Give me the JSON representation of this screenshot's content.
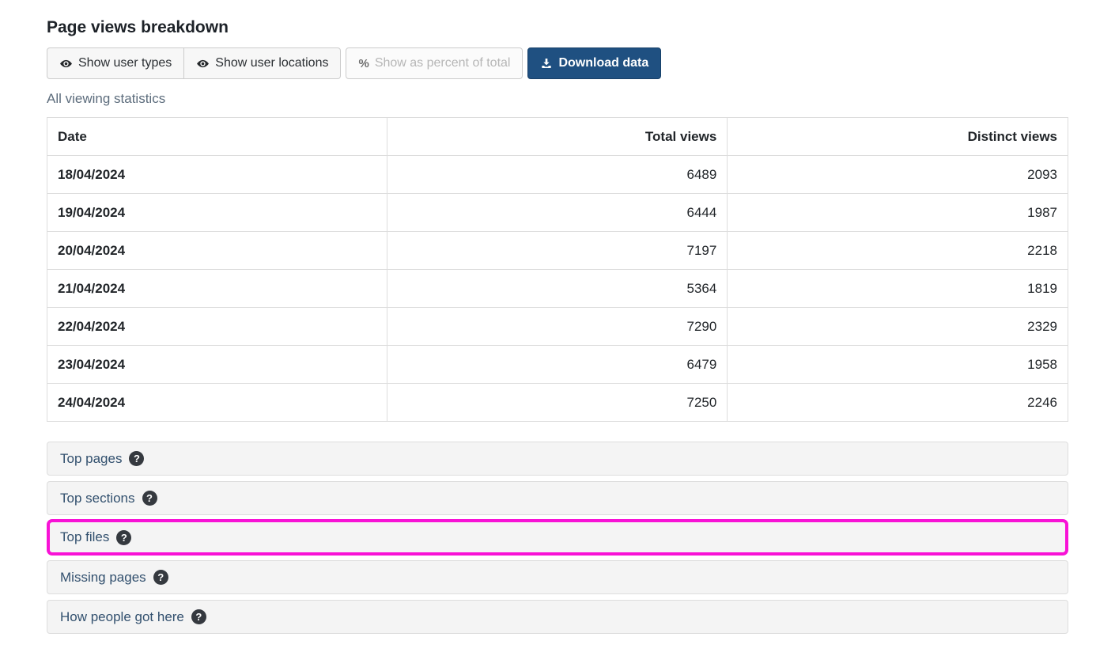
{
  "page": {
    "title": "Page views breakdown",
    "subtitle": "All viewing statistics"
  },
  "toolbar": {
    "buttons": [
      {
        "label": "Show user types",
        "icon": "eye-icon",
        "disabled": false,
        "primary": false
      },
      {
        "label": "Show user locations",
        "icon": "eye-icon",
        "disabled": false,
        "primary": false
      },
      {
        "label": "Show as percent of total",
        "icon": "percent-icon",
        "disabled": true,
        "primary": false
      },
      {
        "label": "Download data",
        "icon": "download-icon",
        "disabled": false,
        "primary": true
      }
    ]
  },
  "table": {
    "columns": [
      "Date",
      "Total views",
      "Distinct views"
    ],
    "rows": [
      {
        "date": "18/04/2024",
        "total_views": "6489",
        "distinct_views": "2093"
      },
      {
        "date": "19/04/2024",
        "total_views": "6444",
        "distinct_views": "1987"
      },
      {
        "date": "20/04/2024",
        "total_views": "7197",
        "distinct_views": "2218"
      },
      {
        "date": "21/04/2024",
        "total_views": "5364",
        "distinct_views": "1819"
      },
      {
        "date": "22/04/2024",
        "total_views": "7290",
        "distinct_views": "2329"
      },
      {
        "date": "23/04/2024",
        "total_views": "6479",
        "distinct_views": "1958"
      },
      {
        "date": "24/04/2024",
        "total_views": "7250",
        "distinct_views": "2246"
      }
    ]
  },
  "accordion": {
    "items": [
      {
        "label": "Top pages",
        "icon": "question-icon",
        "highlighted": false
      },
      {
        "label": "Top sections",
        "icon": "question-icon",
        "highlighted": false
      },
      {
        "label": "Top files",
        "icon": "question-icon",
        "highlighted": true
      },
      {
        "label": "Missing pages",
        "icon": "question-icon",
        "highlighted": false
      },
      {
        "label": "How people got here",
        "icon": "question-icon",
        "highlighted": false
      }
    ]
  },
  "icons": {
    "question_glyph": "?"
  },
  "colors": {
    "primary_button": "#1f5081",
    "highlight_border": "#f812d6",
    "accordion_label": "#32506e",
    "subtitle_text": "#5c6c7c",
    "table_border": "#dddddd"
  }
}
